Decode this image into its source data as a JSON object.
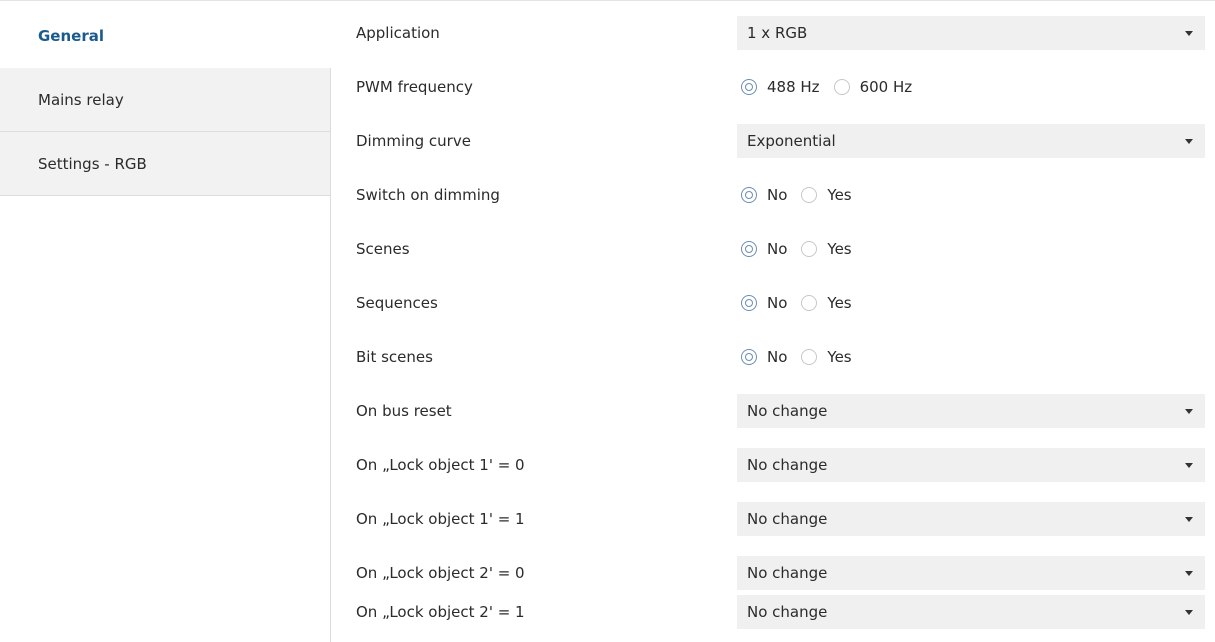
{
  "sidebar": {
    "items": [
      {
        "label": "General",
        "active": true
      },
      {
        "label": "Mains relay",
        "active": false
      },
      {
        "label": "Settings - RGB",
        "active": false
      }
    ]
  },
  "params": {
    "application": {
      "label": "Application",
      "value": "1 x RGB"
    },
    "pwm_frequency": {
      "label": "PWM frequency",
      "options": [
        "488 Hz",
        "600 Hz"
      ],
      "selected": "488 Hz"
    },
    "dimming_curve": {
      "label": "Dimming curve",
      "value": "Exponential"
    },
    "switch_on_dimming": {
      "label": "Switch on dimming",
      "options": [
        "No",
        "Yes"
      ],
      "selected": "No"
    },
    "scenes": {
      "label": "Scenes",
      "options": [
        "No",
        "Yes"
      ],
      "selected": "No"
    },
    "sequences": {
      "label": "Sequences",
      "options": [
        "No",
        "Yes"
      ],
      "selected": "No"
    },
    "bit_scenes": {
      "label": "Bit scenes",
      "options": [
        "No",
        "Yes"
      ],
      "selected": "No"
    },
    "on_bus_reset": {
      "label": "On bus reset",
      "value": "No change"
    },
    "lock1_0": {
      "label": "On „Lock object 1' = 0",
      "value": "No change"
    },
    "lock1_1": {
      "label": "On „Lock object 1' = 1",
      "value": "No change"
    },
    "lock2_0": {
      "label": "On „Lock object 2' = 0",
      "value": "No change"
    },
    "lock2_1": {
      "label": "On „Lock object 2' = 1",
      "value": "No change"
    }
  },
  "colors": {
    "active_nav": "#1b5a8c",
    "nav_bg": "#f2f2f2",
    "select_bg": "#f0f0f0",
    "radio_border": "#6e8db0"
  }
}
